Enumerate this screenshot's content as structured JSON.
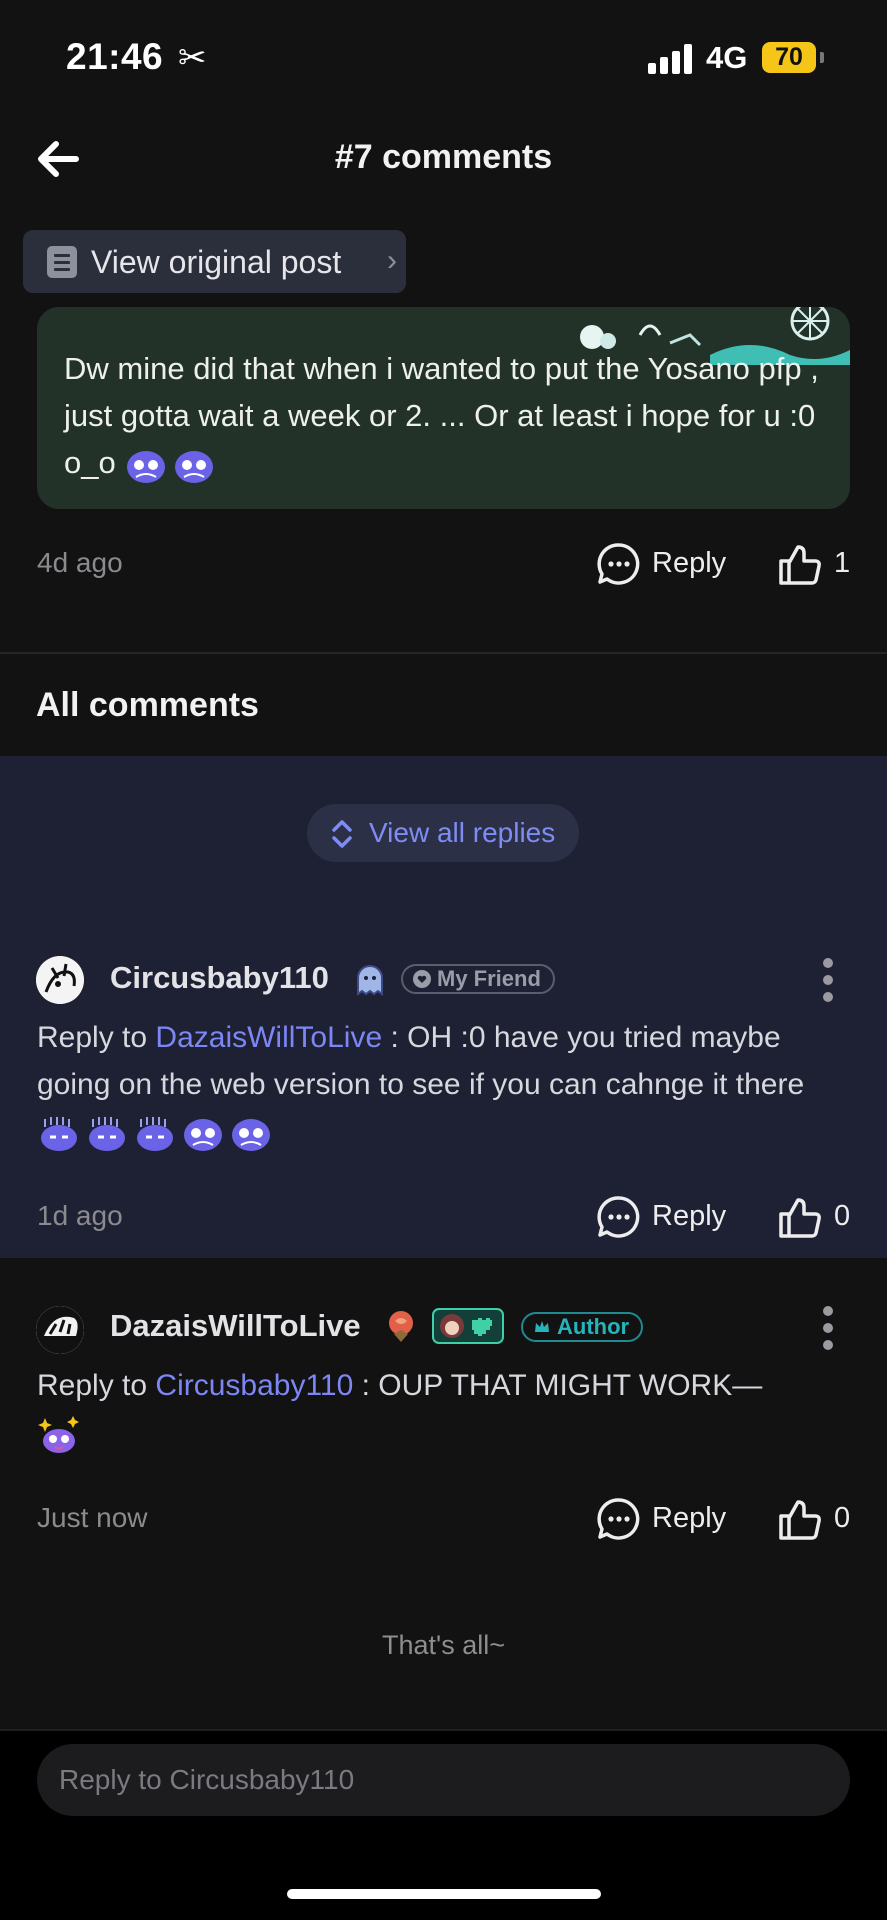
{
  "status_bar": {
    "time": "21:46",
    "network": "4G",
    "battery": "70"
  },
  "header": {
    "title": "#7 comments"
  },
  "view_post": {
    "label": "View original post"
  },
  "quoted_comment": {
    "text": "Dw mine did that when i wanted to put the Yosano pfp , just gotta wait a week or 2. ... Or at least i hope for u :0 o_o",
    "time": "4d ago",
    "reply_label": "Reply",
    "likes": "1"
  },
  "all_comments": {
    "title": "All comments",
    "view_all_replies": "View all replies"
  },
  "comments": [
    {
      "username": "Circusbaby110",
      "badge": "My Friend",
      "reply_prefix": "Reply to",
      "mention": "DazaisWillToLive",
      "text": " : OH :0 have you tried maybe going on the web version to see if you can cahnge it there",
      "time": "1d ago",
      "reply_label": "Reply",
      "likes": "0"
    },
    {
      "username": "DazaisWillToLive",
      "badge": "Author",
      "reply_prefix": "Reply to",
      "mention": "Circusbaby110",
      "text": " : OUP THAT MIGHT WORK—",
      "time": "Just now",
      "reply_label": "Reply",
      "likes": "0"
    }
  ],
  "footer": {
    "end_text": "That's all~"
  },
  "reply_input": {
    "placeholder": "Reply to Circusbaby110"
  },
  "colors": {
    "accent": "#7c86f5",
    "author": "#27b3bb",
    "battery": "#f5c518",
    "bubble": "#233229",
    "thread_bg": "#1e2133"
  }
}
